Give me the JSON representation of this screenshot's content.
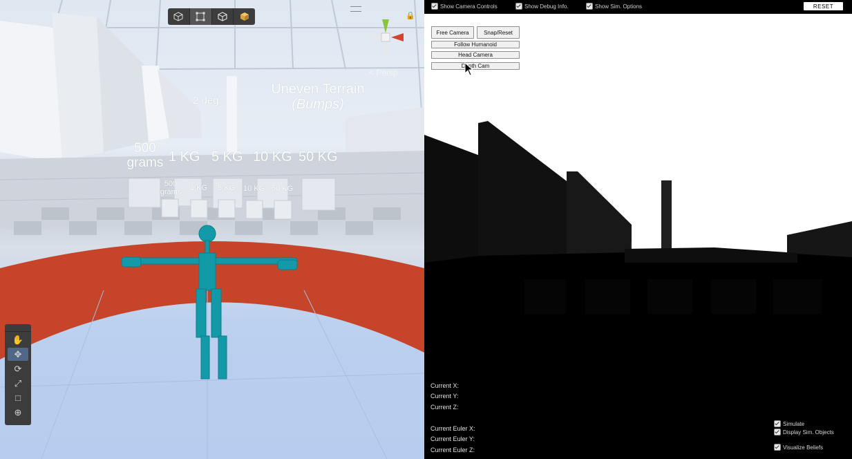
{
  "scene": {
    "labels": {
      "incline": "2 deg.",
      "terrain_line1": "Uneven Terrain",
      "terrain_line2": "(Bumps)",
      "weight_big": [
        "500\ngrams",
        "1 KG",
        "5 KG",
        "10 KG",
        "50 KG"
      ],
      "weight_small": [
        "500\ngrams",
        "1 KG",
        "5 KG",
        "10 KG",
        "50 KG"
      ]
    },
    "view_toolbar": {
      "icons": [
        "cube-outline-icon",
        "rect-transform-icon",
        "cube-wire-icon",
        "cube-solid-icon"
      ]
    },
    "gizmo": {
      "axis_y": "y",
      "axis_x": "x",
      "projection_label": "< Persp"
    },
    "tools": [
      "hand-tool-icon",
      "move-tool-icon",
      "rotate-tool-icon",
      "scale-tool-icon",
      "rect-tool-icon",
      "transform-tool-icon"
    ],
    "colors": {
      "track": "#c5442a",
      "humanoid": "#129aa8",
      "panel": "#3c3c3c"
    }
  },
  "right_panel": {
    "top_toggles": [
      {
        "label": "Show Camera Controls",
        "checked": true
      },
      {
        "label": "Show Debug Info.",
        "checked": true
      },
      {
        "label": "Show Sim. Options",
        "checked": true
      }
    ],
    "reset_label": "RESET",
    "camera_buttons": {
      "free": "Free Camera",
      "snap": "Snap/Reset",
      "follow": "Follow Humanoid",
      "head": "Head Camera",
      "depth": "Depth Cam"
    },
    "debug_info": [
      "Current X:",
      "Current Y:",
      "Current Z:",
      "Current Euler X:",
      "Current Euler Y:",
      "Current Euler Z:"
    ],
    "sim_options": [
      {
        "label": "Simulate",
        "checked": true
      },
      {
        "label": "Display Sim. Objects",
        "checked": true
      },
      {
        "label": "Visualize Beliefs",
        "checked": true
      }
    ]
  }
}
